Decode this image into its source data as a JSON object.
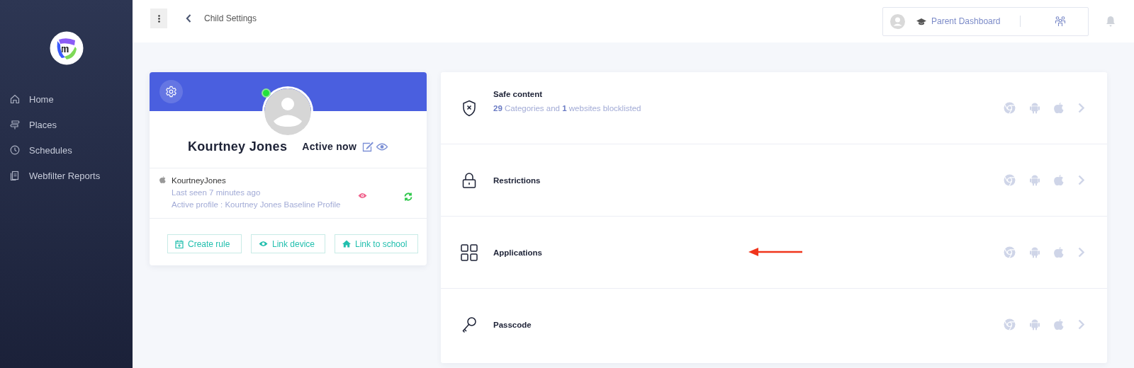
{
  "sidebar": {
    "items": [
      {
        "label": "Home",
        "kind": "home"
      },
      {
        "label": "Places",
        "kind": "signpost"
      },
      {
        "label": "Schedules",
        "kind": "clock"
      },
      {
        "label": "Webfilter Reports",
        "kind": "copy"
      }
    ]
  },
  "header": {
    "title": "Child Settings",
    "dashboard_label": "Parent Dashboard"
  },
  "profile": {
    "name": "Kourtney Jones",
    "status": "Active now",
    "online": true,
    "device_name": "KourtneyJones",
    "last_seen": "Last seen 7 minutes ago",
    "active_profile": "Active profile : Kourtney Jones Baseline Profile",
    "actions": [
      {
        "label": "Create rule",
        "kind": "calendar"
      },
      {
        "label": "Link device",
        "kind": "eye"
      },
      {
        "label": "Link to school",
        "kind": "house"
      }
    ]
  },
  "settings": [
    {
      "title": "Safe content",
      "subtitle": "**29** Categories and **1** websites blocklisted",
      "kind": "shield",
      "highlighted": false
    },
    {
      "title": "Restrictions",
      "kind": "lock",
      "highlighted": false
    },
    {
      "title": "Applications",
      "kind": "grid",
      "highlighted": true
    },
    {
      "title": "Passcode",
      "kind": "key",
      "highlighted": false
    }
  ]
}
